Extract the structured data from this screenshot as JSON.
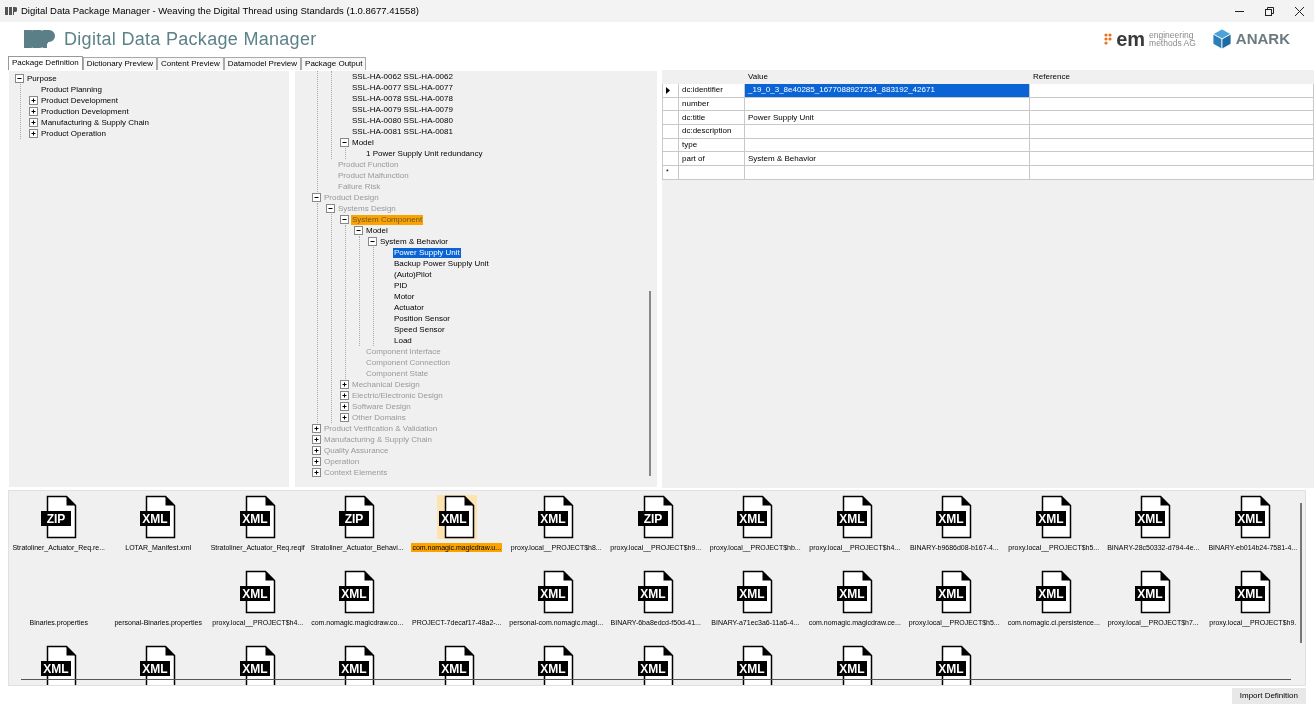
{
  "window": {
    "title": "Digital Data Package Manager - Weaving the Digital Thread using Standards (1.0.8677.41558)"
  },
  "header": {
    "app_name": "Digital Data Package Manager",
    "partner_mark": "em",
    "partner_name_1": "engineering",
    "partner_name_2": "methods AG",
    "brand": "ANARK"
  },
  "tabs": [
    {
      "label": "Package Definition",
      "selected": true
    },
    {
      "label": "Dictionary Preview",
      "selected": false
    },
    {
      "label": "Content Preview",
      "selected": false
    },
    {
      "label": "Datamodel Preview",
      "selected": false
    },
    {
      "label": "Package Output",
      "selected": false
    }
  ],
  "purpose_tree": [
    {
      "label": "Purpose",
      "expanded": true,
      "dimmed": false,
      "selected": false,
      "highlighted": false,
      "children": [
        {
          "label": "Product Planning",
          "dimmed": false,
          "selected": false,
          "highlighted": false
        },
        {
          "label": "Product Development",
          "expanded": false,
          "dimmed": false,
          "selected": false,
          "highlighted": false
        },
        {
          "label": "Production Development",
          "expanded": false,
          "dimmed": false,
          "selected": false,
          "highlighted": false
        },
        {
          "label": "Manufacturing & Supply Chain",
          "expanded": false,
          "dimmed": false,
          "selected": false,
          "highlighted": false
        },
        {
          "label": "Product Operation",
          "expanded": false,
          "dimmed": false,
          "selected": false,
          "highlighted": false
        }
      ]
    }
  ],
  "content_tree": [
    {
      "children": [
        {
          "children": [
            {
              "label": "SSL-HA-0062 SSL-HA-0062",
              "dimmed": false,
              "selected": false,
              "highlighted": false
            },
            {
              "label": "SSL-HA-0077 SSL-HA-0077",
              "dimmed": false,
              "selected": false,
              "highlighted": false
            },
            {
              "label": "SSL-HA-0078 SSL-HA-0078",
              "dimmed": false,
              "selected": false,
              "highlighted": false
            },
            {
              "label": "SSL-HA-0079 SSL-HA-0079",
              "dimmed": false,
              "selected": false,
              "highlighted": false
            },
            {
              "label": "SSL-HA-0080 SSL-HA-0080",
              "dimmed": false,
              "selected": false,
              "highlighted": false
            },
            {
              "label": "SSL-HA-0081 SSL-HA-0081",
              "dimmed": false,
              "selected": false,
              "highlighted": false
            },
            {
              "label": "Model",
              "expanded": true,
              "dimmed": false,
              "selected": false,
              "highlighted": false,
              "children": [
                {
                  "label": "1 Power Supply Unit redundancy",
                  "dimmed": false,
                  "selected": false,
                  "highlighted": false
                }
              ]
            }
          ]
        },
        {
          "label": "Product Function",
          "dimmed": true,
          "selected": false,
          "highlighted": false
        },
        {
          "label": "Product Malfunction",
          "dimmed": true,
          "selected": false,
          "highlighted": false
        },
        {
          "label": "Failure Risk",
          "dimmed": true,
          "selected": false,
          "highlighted": false
        }
      ]
    },
    {
      "label": "Product Design",
      "expanded": true,
      "dimmed": true,
      "selected": false,
      "highlighted": false,
      "children": [
        {
          "label": "Systems Design",
          "expanded": true,
          "dimmed": true,
          "selected": false,
          "highlighted": false,
          "children": [
            {
              "label": "System Component",
              "expanded": true,
              "dimmed": true,
              "selected": false,
              "highlighted": true,
              "children": [
                {
                  "label": "Model",
                  "expanded": true,
                  "dimmed": false,
                  "selected": false,
                  "highlighted": false,
                  "children": [
                    {
                      "label": "System & Behavior",
                      "expanded": true,
                      "dimmed": false,
                      "selected": false,
                      "highlighted": false,
                      "children": [
                        {
                          "label": "Power Supply Unit",
                          "dimmed": false,
                          "selected": true,
                          "highlighted": false
                        },
                        {
                          "label": "Backup Power Supply Unit",
                          "dimmed": false,
                          "selected": false,
                          "highlighted": false
                        },
                        {
                          "label": "(Auto)Pilot",
                          "dimmed": false,
                          "selected": false,
                          "highlighted": false
                        },
                        {
                          "label": "PID",
                          "dimmed": false,
                          "selected": false,
                          "highlighted": false
                        },
                        {
                          "label": "Motor",
                          "dimmed": false,
                          "selected": false,
                          "highlighted": false
                        },
                        {
                          "label": "Actuator",
                          "dimmed": false,
                          "selected": false,
                          "highlighted": false
                        },
                        {
                          "label": "Position Sensor",
                          "dimmed": false,
                          "selected": false,
                          "highlighted": false
                        },
                        {
                          "label": "Speed Sensor",
                          "dimmed": false,
                          "selected": false,
                          "highlighted": false
                        },
                        {
                          "label": "Load",
                          "dimmed": false,
                          "selected": false,
                          "highlighted": false
                        }
                      ]
                    }
                  ]
                },
                {
                  "label": "Component Interface",
                  "dimmed": true,
                  "selected": false,
                  "highlighted": false
                },
                {
                  "label": "Component Connection",
                  "dimmed": true,
                  "selected": false,
                  "highlighted": false
                },
                {
                  "label": "Component State",
                  "dimmed": true,
                  "selected": false,
                  "highlighted": false
                }
              ]
            },
            {
              "label": "Mechanical Design",
              "expanded": false,
              "dimmed": true,
              "selected": false,
              "highlighted": false
            },
            {
              "label": "Electric/Electronic Design",
              "expanded": false,
              "dimmed": true,
              "selected": false,
              "highlighted": false
            },
            {
              "label": "Software Design",
              "expanded": false,
              "dimmed": true,
              "selected": false,
              "highlighted": false
            },
            {
              "label": "Other Domains",
              "expanded": false,
              "dimmed": true,
              "selected": false,
              "highlighted": false
            }
          ]
        }
      ]
    },
    {
      "label": "Product Verification & Validation",
      "expanded": false,
      "dimmed": true,
      "selected": false,
      "highlighted": false
    },
    {
      "label": "Manufacturing & Supply Chain",
      "expanded": false,
      "dimmed": true,
      "selected": false,
      "highlighted": false
    },
    {
      "label": "Quality Assurance",
      "expanded": false,
      "dimmed": true,
      "selected": false,
      "highlighted": false
    },
    {
      "label": "Operation",
      "expanded": false,
      "dimmed": true,
      "selected": false,
      "highlighted": false
    },
    {
      "label": "Context Elements",
      "expanded": false,
      "dimmed": true,
      "selected": false,
      "highlighted": false
    }
  ],
  "properties": {
    "columns": [
      "Value",
      "Reference"
    ],
    "new_row_marker": "*",
    "rows": [
      {
        "field": "dc:identifier",
        "value": "_19_0_3_8e40285_1677088927234_883192_42671",
        "current": true,
        "selected": true
      },
      {
        "field": "number",
        "current": false,
        "selected": false
      },
      {
        "field": "dc:title",
        "value": "Power Supply Unit",
        "current": false,
        "selected": false
      },
      {
        "field": "dc:description",
        "current": false,
        "selected": false
      },
      {
        "field": "type",
        "current": false,
        "selected": false
      },
      {
        "field": "part of",
        "value": "System & Behavior",
        "current": false,
        "selected": false
      }
    ]
  },
  "files": [
    {
      "badge": "ZIP",
      "name": "Stratoliner_Actuator_Req.re...",
      "selected": false
    },
    {
      "badge": "XML",
      "name": "LOTAR_Manifest.xml",
      "selected": false
    },
    {
      "badge": "XML",
      "name": "Stratoliner_Actuator_Req.reqif",
      "selected": false
    },
    {
      "badge": "ZIP",
      "name": "Stratoliner_Actuator_Behavi...",
      "selected": false
    },
    {
      "badge": "XML",
      "name": "com.nomagic.magicdraw.u...",
      "selected": true
    },
    {
      "badge": "XML",
      "name": "proxy.local__PROJECT$h8...",
      "selected": false
    },
    {
      "badge": "ZIP",
      "name": "proxy.local__PROJECT$h9...",
      "selected": false
    },
    {
      "badge": "XML",
      "name": "proxy.local__PROJECT$hb...",
      "selected": false
    },
    {
      "badge": "XML",
      "name": "proxy.local__PROJECT$h4...",
      "selected": false
    },
    {
      "badge": "XML",
      "name": "BINARY-b9686d08-b167-4...",
      "selected": false
    },
    {
      "badge": "XML",
      "name": "proxy.local__PROJECT$h5...",
      "selected": false
    },
    {
      "badge": "XML",
      "name": "BINARY-28c50332-d794-4e...",
      "selected": false
    },
    {
      "badge": "XML",
      "name": "BINARY-eb014b24-7581-4...",
      "selected": false
    },
    {
      "name": "Binaries.properties",
      "selected": false
    },
    {
      "name": "personal-Binaries.properties",
      "selected": false
    },
    {
      "badge": "XML",
      "name": "proxy.local__PROJECT$h4...",
      "selected": false
    },
    {
      "badge": "XML",
      "name": "com.nomagic.magicdraw.co...",
      "selected": false
    },
    {
      "name": "PROJECT-7decaf17-48a2-...",
      "selected": false
    },
    {
      "badge": "XML",
      "name": "personal-com.nomagic.magi...",
      "selected": false
    },
    {
      "badge": "XML",
      "name": "BINARY-6ba8edcd-f50d-41...",
      "selected": false
    },
    {
      "badge": "XML",
      "name": "BINARY-a71ec3a6-11a6-4...",
      "selected": false
    },
    {
      "badge": "XML",
      "name": "com.nomagic.magicdraw.ce...",
      "selected": false
    },
    {
      "badge": "XML",
      "name": "proxy.local__PROJECT$h5...",
      "selected": false
    },
    {
      "badge": "XML",
      "name": "com.nomagic.ci.persistence...",
      "selected": false
    },
    {
      "badge": "XML",
      "name": "proxy.local__PROJECT$h7...",
      "selected": false
    },
    {
      "badge": "XML",
      "name": "proxy.local__PROJECT$h9.",
      "selected": false
    },
    {
      "badge": "XML",
      "selected": false
    },
    {
      "badge": "XML",
      "selected": false
    },
    {
      "badge": "XML",
      "selected": false
    },
    {
      "badge": "XML",
      "selected": false
    },
    {
      "badge": "XML",
      "selected": false
    },
    {
      "badge": "XML",
      "selected": false
    },
    {
      "badge": "XML",
      "selected": false
    },
    {
      "badge": "XML",
      "selected": false
    },
    {
      "badge": "XML",
      "selected": false
    },
    {
      "badge": "XML",
      "selected": false
    }
  ],
  "footer": {
    "button": "Import Definition"
  }
}
